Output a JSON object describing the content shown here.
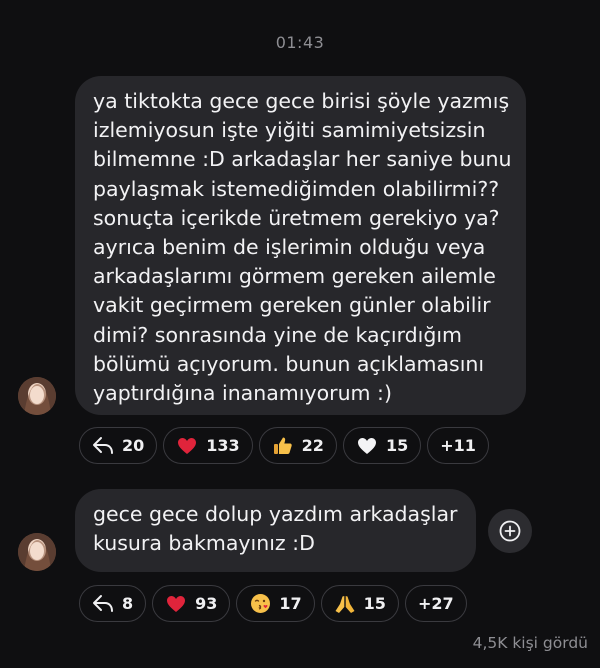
{
  "timestamp": "01:43",
  "messages": [
    {
      "lines": [
        "ya tiktokta gece gece birisi şöyle yazmış",
        "izlemiyosun işte yiğiti samimiyetsizsin",
        "bilmemne :D arkadaşlar her saniye bunu",
        "paylaşmak istemediğimden olabilirmi??",
        "sonuçta içerikde üretmem gerekiyo ya?",
        "ayrıca benim de işlerimin olduğu veya",
        "arkadaşlarımı görmem gereken ailemle",
        "vakit geçirmem gereken günler olabilir",
        "dimi? sonrasında yine de kaçırdığım",
        "bölümü açıyorum. bunun açıklamasını",
        "yaptırdığına inanamıyorum :)"
      ],
      "reactions": [
        {
          "icon": "reply-icon",
          "count": "20"
        },
        {
          "icon": "red-heart-icon",
          "count": "133"
        },
        {
          "icon": "thumbs-up-icon",
          "count": "22"
        },
        {
          "icon": "white-heart-icon",
          "count": "15"
        },
        {
          "icon": "more",
          "count": "+11"
        }
      ]
    },
    {
      "lines": [
        "gece gece dolup yazdım arkadaşlar",
        "kusura bakmayınız :D"
      ],
      "reactions": [
        {
          "icon": "reply-icon",
          "count": "8"
        },
        {
          "icon": "red-heart-icon",
          "count": "93"
        },
        {
          "icon": "kissing-face-icon",
          "count": "17"
        },
        {
          "icon": "folded-hands-icon",
          "count": "15"
        },
        {
          "icon": "more",
          "count": "+27"
        }
      ]
    }
  ],
  "seen_label": "4,5K kişi gördü",
  "colors": {
    "background": "#0f0f11",
    "bubble": "#27272b",
    "text": "#f2f2f4",
    "muted": "#8e8e93",
    "pill_border": "#3a3a3f"
  }
}
